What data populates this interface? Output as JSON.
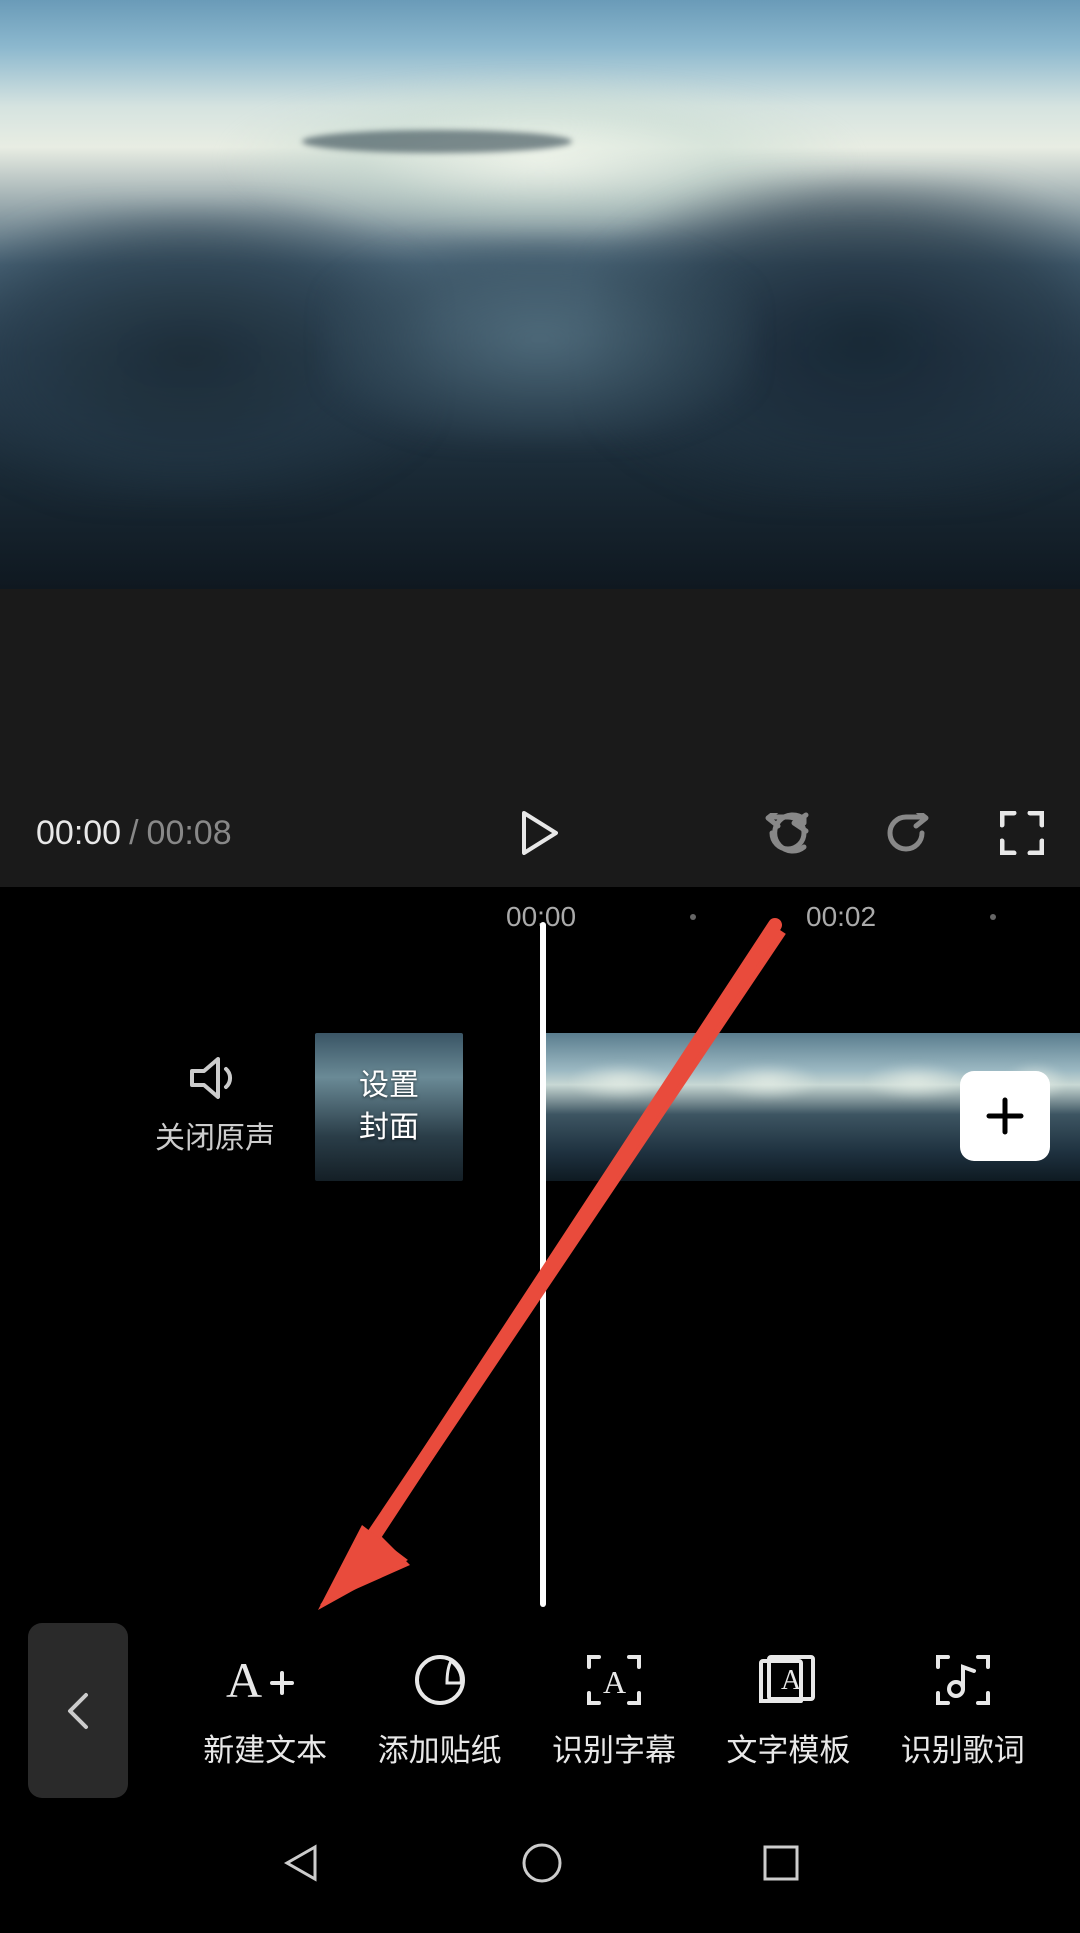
{
  "playback": {
    "current_time": "00:00",
    "separator": "/",
    "total_time": "00:08"
  },
  "ruler": {
    "mark1": "00:00",
    "mark2": "00:02"
  },
  "track": {
    "mute_label": "关闭原声",
    "cover_label_line1": "设置",
    "cover_label_line2": "封面"
  },
  "toolbar": {
    "new_text": "新建文本",
    "add_sticker": "添加贴纸",
    "recognize_subtitle": "识别字幕",
    "text_template": "文字模板",
    "recognize_lyrics": "识别歌词"
  }
}
